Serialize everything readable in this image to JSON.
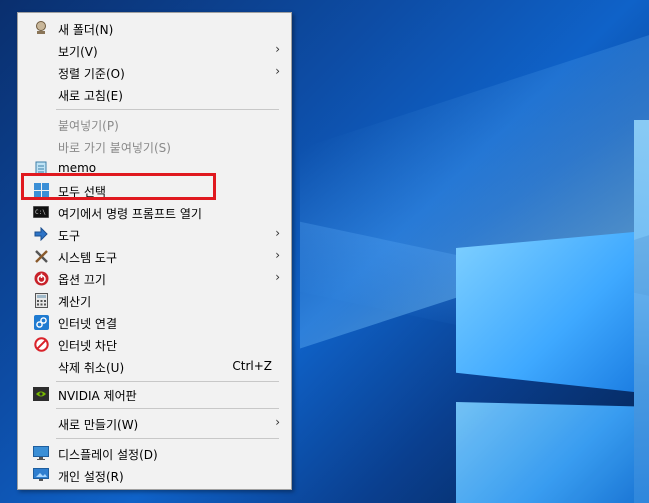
{
  "context_menu": {
    "items": [
      {
        "label": "새 폴더(N)",
        "icon": "new-folder-icon"
      },
      {
        "label": "보기(V)",
        "submenu": true
      },
      {
        "label": "정렬 기준(O)",
        "submenu": true
      },
      {
        "label": "새로 고침(E)"
      },
      {
        "label": "붙여넣기(P)",
        "disabled": true
      },
      {
        "label": "바로 가기 붙여넣기(S)",
        "disabled": true
      },
      {
        "label": "memo",
        "icon": "notepad-icon"
      },
      {
        "label": "모두 선택",
        "icon": "select-all-icon"
      },
      {
        "label": "여기에서 명령 프롬프트 열기",
        "icon": "command-prompt-icon"
      },
      {
        "label": "도구",
        "icon": "tools-arrow-icon",
        "submenu": true
      },
      {
        "label": "시스템 도구",
        "icon": "system-tools-icon",
        "submenu": true
      },
      {
        "label": "옵션 끄기",
        "icon": "power-off-icon",
        "submenu": true
      },
      {
        "label": "계산기",
        "icon": "calculator-icon"
      },
      {
        "label": "인터넷 연결",
        "icon": "internet-connect-icon"
      },
      {
        "label": "인터넷 차단",
        "icon": "internet-block-icon"
      },
      {
        "label": "삭제 취소(U)",
        "shortcut": "Ctrl+Z"
      },
      {
        "label": "NVIDIA 제어판",
        "icon": "nvidia-icon"
      },
      {
        "label": "새로 만들기(W)",
        "submenu": true
      },
      {
        "label": "디스플레이 설정(D)",
        "icon": "display-settings-icon"
      },
      {
        "label": "개인 설정(R)",
        "icon": "personalize-icon"
      }
    ]
  },
  "highlight_color": "#e0191f",
  "menu_background": "#f2f2f2",
  "submenu_arrow": "›"
}
